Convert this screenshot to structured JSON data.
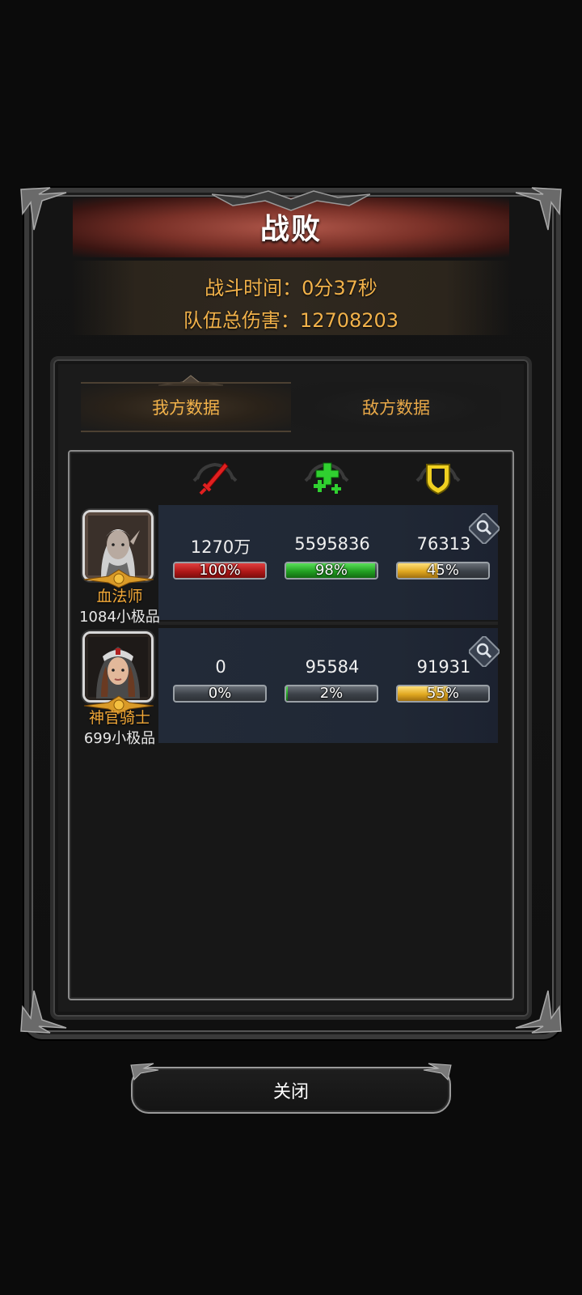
{
  "dialog": {
    "title": "战败",
    "battle_time": "战斗时间：0分37秒",
    "team_damage": "队伍总伤害：12708203",
    "close_label": "关闭"
  },
  "tabs": [
    {
      "label": "我方数据",
      "active": true
    },
    {
      "label": "敌方数据",
      "active": false
    }
  ],
  "columns": [
    {
      "icon": "sword-damage-icon",
      "color": "#e02020"
    },
    {
      "icon": "healing-cross-icon",
      "color": "#30d030"
    },
    {
      "icon": "shield-tank-icon",
      "color": "#f0d020"
    }
  ],
  "heroes": [
    {
      "name": "血法师",
      "grade": "1084小极品",
      "damage": {
        "value": "1270万",
        "percent_label": "100%",
        "percent": 100
      },
      "healing": {
        "value": "5595836",
        "percent_label": "98%",
        "percent": 98
      },
      "tanked": {
        "value": "76313",
        "percent_label": "45%",
        "percent": 45
      }
    },
    {
      "name": "神官骑士",
      "grade": "699小极品",
      "damage": {
        "value": "0",
        "percent_label": "0%",
        "percent": 0
      },
      "healing": {
        "value": "95584",
        "percent_label": "2%",
        "percent": 2
      },
      "tanked": {
        "value": "91931",
        "percent_label": "55%",
        "percent": 55
      }
    }
  ]
}
